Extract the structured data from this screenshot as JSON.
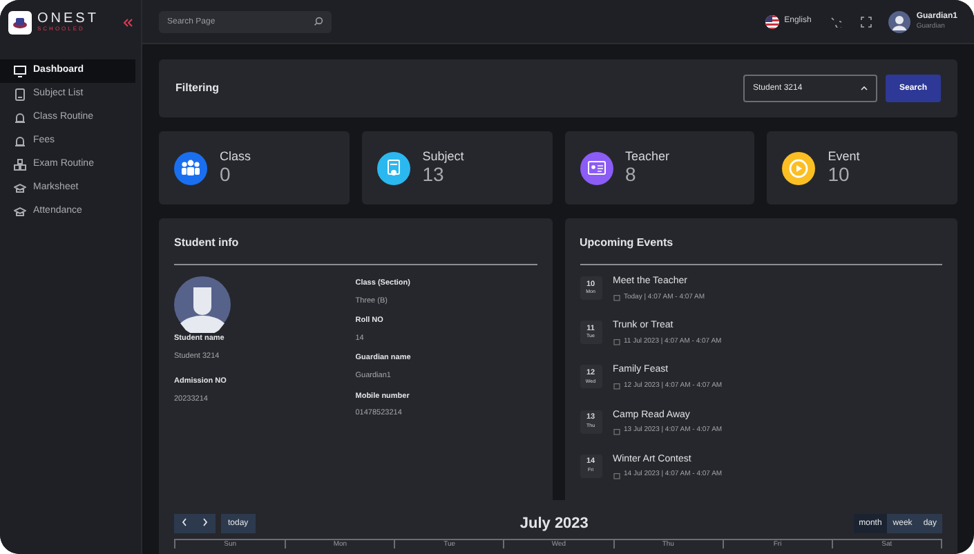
{
  "logo": {
    "title": "ONEST",
    "subtitle": "SCHOOLED"
  },
  "search": {
    "placeholder": "Search Page"
  },
  "topbar": {
    "language": "English",
    "user": {
      "name": "Guardian1",
      "role": "Guardian"
    }
  },
  "sidebar": {
    "items": [
      {
        "label": "Dashboard",
        "selected": true
      },
      {
        "label": "Subject List",
        "selected": false
      },
      {
        "label": "Class Routine",
        "selected": false
      },
      {
        "label": "Fees",
        "selected": false
      },
      {
        "label": "Exam Routine",
        "selected": false
      },
      {
        "label": "Marksheet",
        "selected": false
      },
      {
        "label": "Attendance",
        "selected": false
      }
    ]
  },
  "filtering": {
    "title": "Filtering",
    "select": {
      "value": "Student 3214"
    },
    "button": "Search"
  },
  "stats": [
    {
      "label": "Class",
      "value": "0",
      "color": "#1a6ff0"
    },
    {
      "label": "Subject",
      "value": "13",
      "color": "#2bb8f0"
    },
    {
      "label": "Teacher",
      "value": "8",
      "color": "#8b5cf6"
    },
    {
      "label": "Event",
      "value": "10",
      "color": "#fbbf24"
    }
  ],
  "student_info": {
    "title": "Student info",
    "left_fields": [
      {
        "label": "Student name",
        "value": "Student 3214"
      },
      {
        "label": "Admission NO",
        "value": "20233214"
      }
    ],
    "right_fields": [
      {
        "label": "Class (Section)",
        "value": "Three (B)"
      },
      {
        "label": "Roll NO",
        "value": "14"
      },
      {
        "label": "Guardian name",
        "value": "Guardian1"
      },
      {
        "label": "Mobile number",
        "value": "01478523214"
      }
    ]
  },
  "events": {
    "title": "Upcoming Events",
    "items": [
      {
        "day": "10",
        "weekday": "Mon",
        "title": "Meet the Teacher",
        "time": "Today | 4:07 AM - 4:07 AM"
      },
      {
        "day": "11",
        "weekday": "Tue",
        "title": "Trunk or Treat",
        "time": "11 Jul 2023 | 4:07 AM - 4:07 AM"
      },
      {
        "day": "12",
        "weekday": "Wed",
        "title": "Family Feast",
        "time": "12 Jul 2023 | 4:07 AM - 4:07 AM"
      },
      {
        "day": "13",
        "weekday": "Thu",
        "title": "Camp Read Away",
        "time": "13 Jul 2023 | 4:07 AM - 4:07 AM"
      },
      {
        "day": "14",
        "weekday": "Fri",
        "title": "Winter Art Contest",
        "time": "14 Jul 2023 | 4:07 AM - 4:07 AM"
      }
    ]
  },
  "calendar": {
    "title": "July 2023",
    "today": "today",
    "views": [
      {
        "label": "month",
        "selected": true
      },
      {
        "label": "week",
        "selected": false
      },
      {
        "label": "day",
        "selected": false
      }
    ],
    "weekdays": [
      "Sun",
      "Mon",
      "Tue",
      "Wed",
      "Thu",
      "Fri",
      "Sat"
    ]
  }
}
